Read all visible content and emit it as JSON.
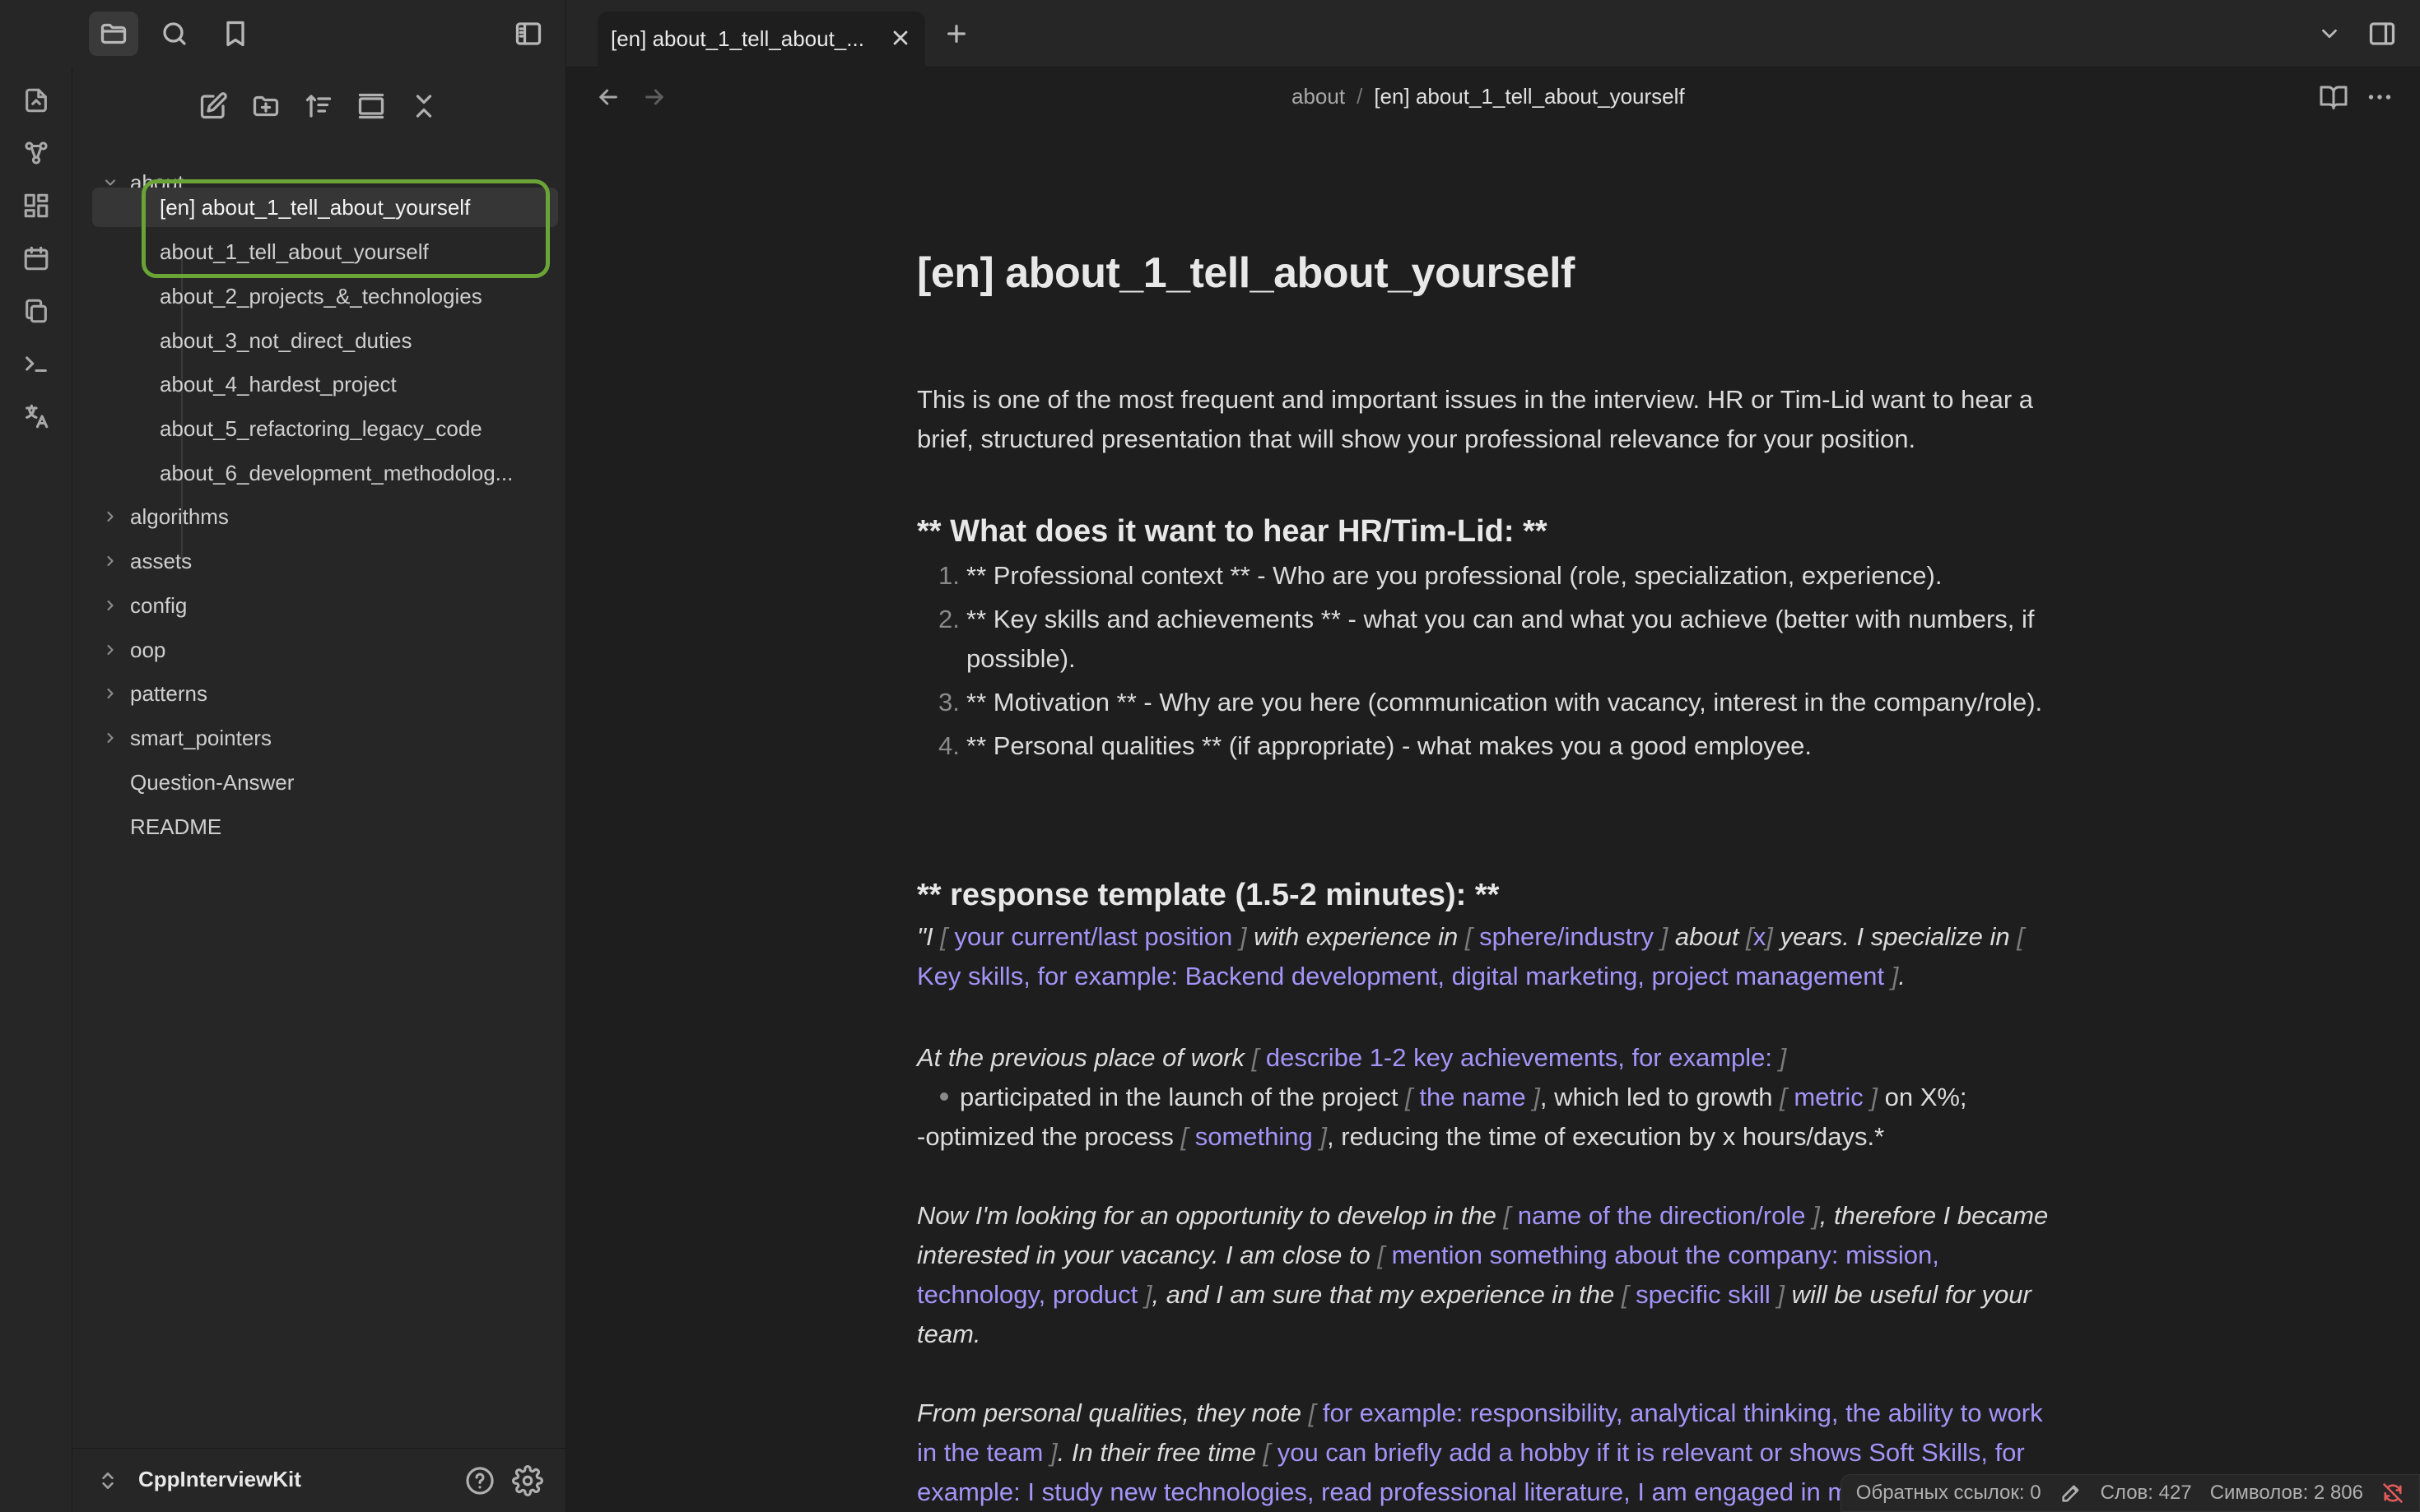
{
  "topbar": {
    "tab_title": "[en] about_1_tell_about_...",
    "buttons": [
      "file-explorer",
      "search",
      "bookmarks",
      "toggle-sidebar",
      "close-tab",
      "new-tab",
      "tab-list",
      "toggle-right-sidebar"
    ]
  },
  "ribbon": {
    "icons": [
      "open-quick-switcher-icon",
      "graph-view-icon",
      "canvas-icon",
      "daily-note-icon",
      "templates-icon",
      "terminal-icon",
      "translate-icon"
    ]
  },
  "sidebar": {
    "tree": {
      "root_folder": "about",
      "children": [
        "[en] about_1_tell_about_yourself",
        "about_1_tell_about_yourself",
        "about_2_projects_&_technologies",
        "about_3_not_direct_duties",
        "about_4_hardest_project",
        "about_5_refactoring_legacy_code",
        "about_6_development_methodolog..."
      ],
      "folders": [
        "algorithms",
        "assets",
        "config",
        "oop",
        "patterns",
        "smart_pointers"
      ],
      "files": [
        "Question-Answer",
        "README"
      ]
    },
    "vault_name": "CppInterviewKit"
  },
  "breadcrumb": {
    "folder": "about",
    "separator": "/",
    "current": "[en] about_1_tell_about_yourself"
  },
  "doc": {
    "title": "[en] about_1_tell_about_yourself",
    "intro": "This is one of the most frequent and important issues in the interview. HR or Tim-Lid want to hear a brief, structured presentation that will show your professional relevance for your position.",
    "heading1": "** What does it want to hear HR/Tim-Lid: **",
    "list": [
      {
        "num": "1.",
        "text": "** Professional context ** - Who are you professional (role, specialization, experience)."
      },
      {
        "num": "2.",
        "text": "** Key skills and achievements ** - what you can and what you achieve (better with numbers, if possible)."
      },
      {
        "num": "3.",
        "text": "** Motivation ** - Why are you here (communication with vacancy, interest in the company/role)."
      },
      {
        "num": "4.",
        "text": "** Personal qualities ** (if appropriate) - what makes you a good employee."
      }
    ],
    "heading2": "** response template (1.5-2 minutes): **",
    "p1": {
      "t1": "\"I ",
      "ph1": "your current/last position",
      "t2": " with experience in ",
      "ph2": "sphere/industry",
      "t3": " about ",
      "ph3": "x",
      "t4": " years. I specialize in ",
      "ph4": "Key skills, for example: Backend development, digital marketing, project management",
      "t5": "."
    },
    "p2": {
      "t1": "At the previous place of work ",
      "ph1": "describe 1-2 key achievements, for example:",
      "b1": "participated in the launch of the project ",
      "ph2": "the name",
      "b2": ", which led to growth ",
      "ph3": "metric",
      "b3": " on X%;",
      "l2a": "-optimized the process ",
      "ph4": "something",
      "l2b": ", reducing the time of execution by x hours/days.*"
    },
    "p3": {
      "t1": "Now I'm looking for an opportunity to develop in the ",
      "ph1": "name of the direction/role",
      "t2": ", therefore I became interested in your vacancy. I am close to ",
      "ph2": "mention something about the company: mission, technology, product",
      "t3": ", and I am sure that my experience in the ",
      "ph3": "specific skill",
      "t4": " will be useful for your team."
    },
    "p4": {
      "t1": "From personal qualities, they note ",
      "ph1": "for example: responsibility, analytical thinking, the ability to work in the team",
      "t2": ". In their free time ",
      "ph2": "you can briefly add a hobby if it is relevant or shows Soft Skills, for example: I study new technologies, read professional literature, I am engaged in mentor",
      "t3": ". \"\"*"
    },
    "bracket_open": "[",
    "bracket_close": "]"
  },
  "status": {
    "backlinks": "Обратных ссылок: 0",
    "words": "Слов: 427",
    "chars": "Символов: 2 806"
  },
  "colors": {
    "accent_placeholder": "#a394f7",
    "highlight_box": "#6aa336",
    "background": "#1e1e1e",
    "panel": "#262626"
  }
}
